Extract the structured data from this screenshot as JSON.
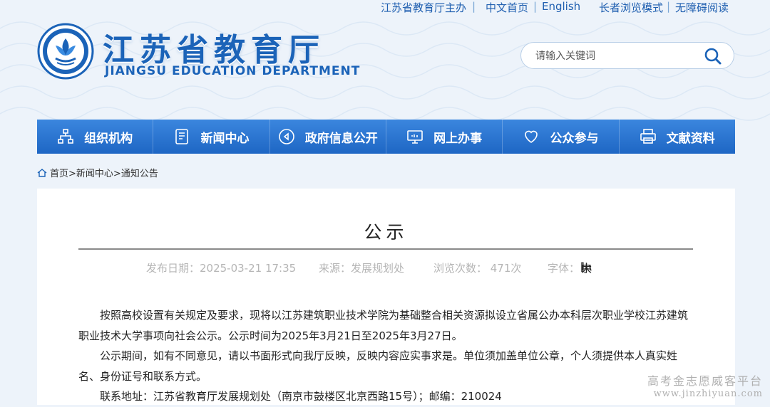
{
  "header": {
    "top_links": [
      "江苏省教育厅主办",
      "中文首页",
      "English",
      "长者浏览模式",
      "无障碍阅读"
    ],
    "site_title_cn": "江苏省教育厅",
    "site_title_en": "JIANGSU EDUCATION DEPARTMENT",
    "search": {
      "placeholder": "请输入关键词",
      "icon": "search-icon"
    }
  },
  "nav": {
    "items": [
      {
        "label": "组织机构",
        "icon": "org-chart-icon"
      },
      {
        "label": "新闻中心",
        "icon": "document-icon"
      },
      {
        "label": "政府信息公开",
        "icon": "play-circle-icon"
      },
      {
        "label": "网上办事",
        "icon": "monitor-icon"
      },
      {
        "label": "公众参与",
        "icon": "heart-icon"
      },
      {
        "label": "文献资料",
        "icon": "printer-icon"
      }
    ]
  },
  "breadcrumb": {
    "home": "首页>",
    "section": "新闻中心>",
    "current": "通知公告"
  },
  "article": {
    "title": "公示",
    "meta": {
      "date": "发布日期：2025-03-21 17:35",
      "source": "来源：发展规划处",
      "views": "浏览次数：  471次",
      "font_label": "字体：",
      "bracket_open": "[",
      "font_large": "大",
      "font_medium": "中",
      "font_small": "小",
      "bracket_close": "]"
    },
    "paragraphs": [
      "按照高校设置有关规定及要求，现将以江苏建筑职业技术学院为基础整合相关资源拟设立省属公办本科层次职业学校江苏建筑职业技术大学事项向社会公示。公示时间为2025年3月21日至2025年3月27日。",
      "公示期间，如有不同意见，请以书面形式向我厅反映，反映内容应实事求是。单位须加盖单位公章，个人须提供本人真实姓名、身份证号和联系方式。",
      "联系地址：江苏省教育厅发展规划处（南京市鼓楼区北京西路15号）；邮编：210024"
    ]
  },
  "watermark": {
    "line1": "高考金志愿威客平台",
    "line2": "www.jinzhiyuan.com"
  },
  "colors": {
    "brand": "#1b63b8",
    "nav": "#2a74d0",
    "page_bg": "#edf3fa"
  }
}
